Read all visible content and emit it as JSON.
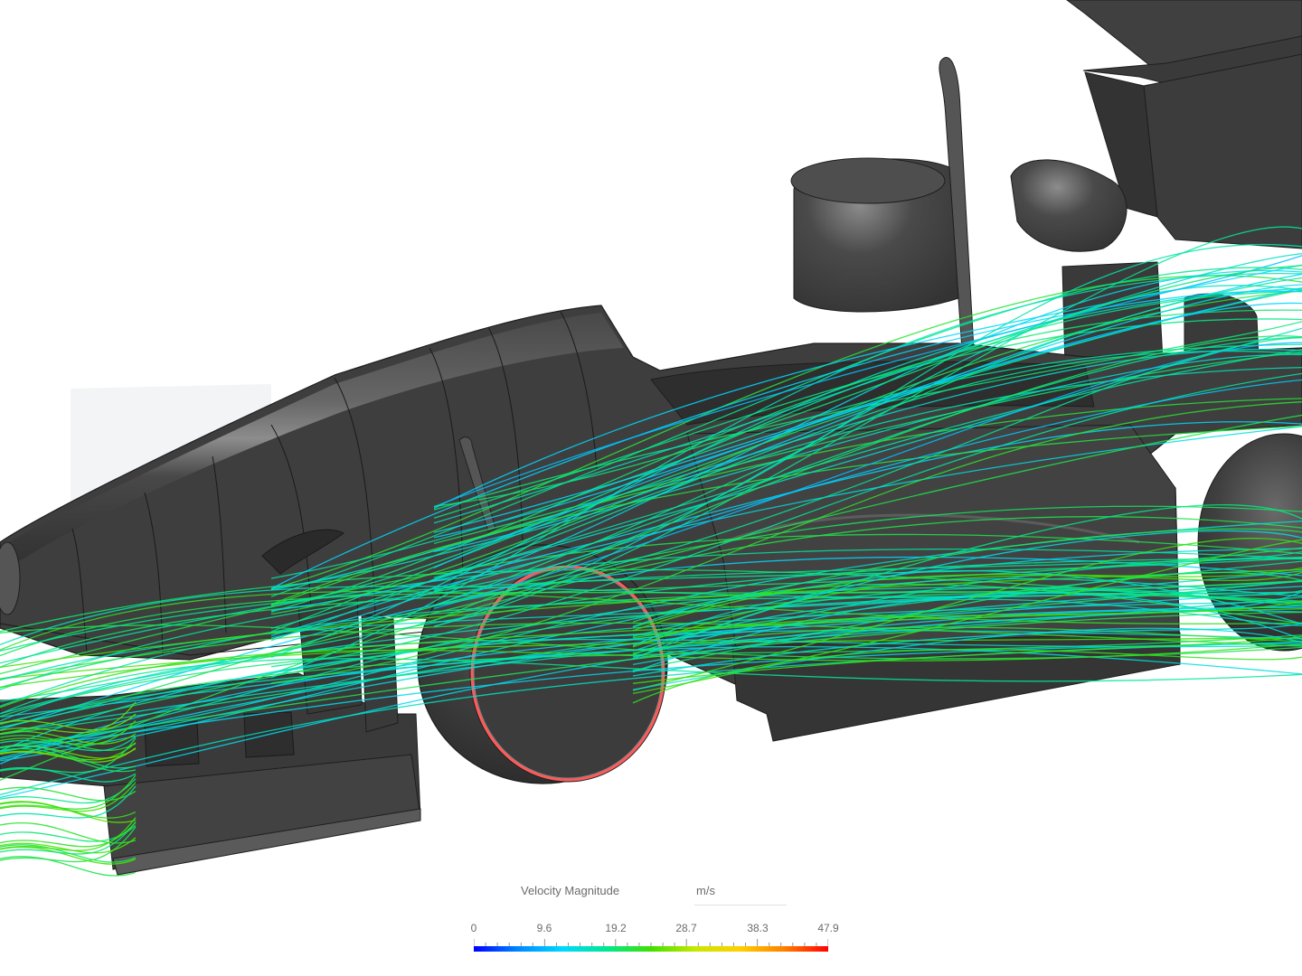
{
  "legend": {
    "quantity_label": "Velocity Magnitude",
    "unit_label": "m/s",
    "min": 0,
    "max": 47.9,
    "tick_labels": [
      "0",
      "9.6",
      "19.2",
      "28.7",
      "38.3",
      "47.9"
    ],
    "colormap": [
      "#0000ff",
      "#0088ff",
      "#00d8ff",
      "#00e890",
      "#40e000",
      "#c8e800",
      "#ffd000",
      "#ff8000",
      "#ff0000"
    ]
  },
  "scene": {
    "body_color": "#3d3d3d",
    "highlight_color": "#9a9a9a",
    "wheel_rim_color": "#ff5a5a"
  }
}
